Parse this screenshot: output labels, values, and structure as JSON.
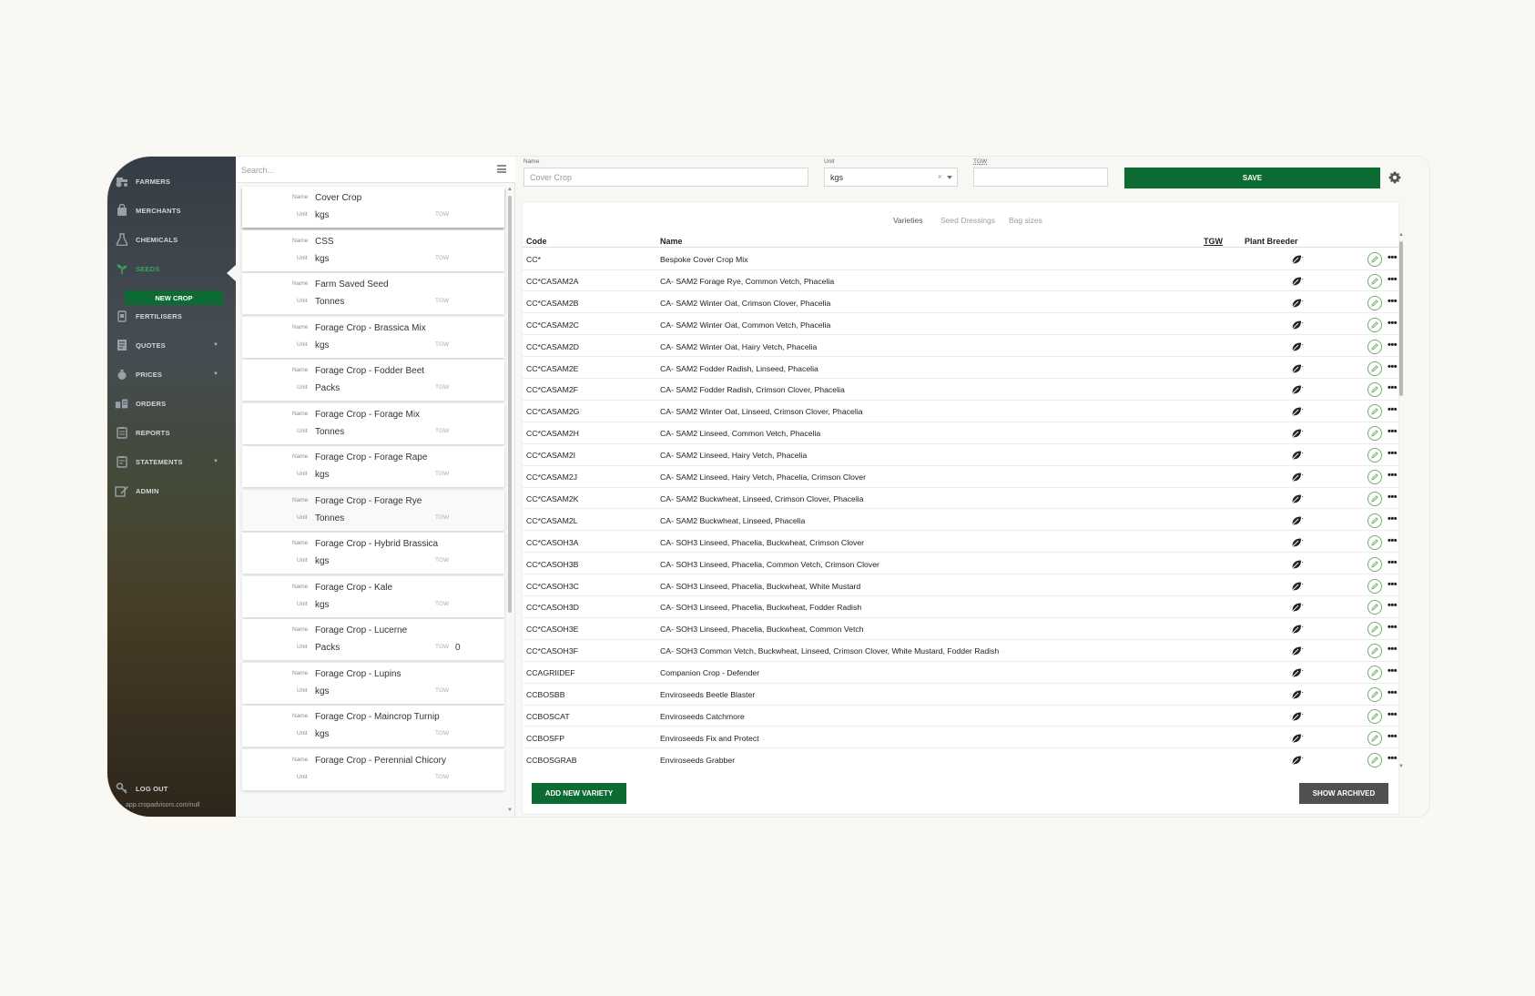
{
  "sidebar": {
    "items": [
      {
        "label": "FARMERS",
        "icon": "tractor-icon"
      },
      {
        "label": "MERCHANTS",
        "icon": "bag-icon"
      },
      {
        "label": "CHEMICALS",
        "icon": "flask-icon"
      },
      {
        "label": "SEEDS",
        "icon": "seedling-icon"
      },
      {
        "label": "FERTILISERS",
        "icon": "fertiliser-icon"
      },
      {
        "label": "QUOTES",
        "icon": "document-icon"
      },
      {
        "label": "PRICES",
        "icon": "money-bag-icon"
      },
      {
        "label": "ORDERS",
        "icon": "orders-icon"
      },
      {
        "label": "REPORTS",
        "icon": "clipboard-icon"
      },
      {
        "label": "STATEMENTS",
        "icon": "statement-icon"
      },
      {
        "label": "ADMIN",
        "icon": "edit-icon"
      }
    ],
    "active": "SEEDS",
    "new_crop_label": "NEW CROP",
    "logout_label": "LOG OUT",
    "footer_url": "app.cropadvisors.com/null"
  },
  "list": {
    "search_placeholder": "Search...",
    "field_labels": {
      "name": "Name",
      "unit": "Unit",
      "tgw": "TGW"
    },
    "crops": [
      {
        "name": "Cover Crop",
        "unit": "kgs",
        "tgw": ""
      },
      {
        "name": "CSS",
        "unit": "kgs",
        "tgw": ""
      },
      {
        "name": "Farm Saved Seed",
        "unit": "Tonnes",
        "tgw": ""
      },
      {
        "name": "Forage Crop - Brassica Mix",
        "unit": "kgs",
        "tgw": ""
      },
      {
        "name": "Forage Crop - Fodder Beet",
        "unit": "Packs",
        "tgw": ""
      },
      {
        "name": "Forage Crop - Forage Mix",
        "unit": "Tonnes",
        "tgw": ""
      },
      {
        "name": "Forage Crop - Forage Rape",
        "unit": "kgs",
        "tgw": ""
      },
      {
        "name": "Forage Crop - Forage Rye",
        "unit": "Tonnes",
        "tgw": ""
      },
      {
        "name": "Forage Crop - Hybrid Brassica",
        "unit": "kgs",
        "tgw": ""
      },
      {
        "name": "Forage Crop - Kale",
        "unit": "kgs",
        "tgw": ""
      },
      {
        "name": "Forage Crop - Lucerne",
        "unit": "Packs",
        "tgw": "0"
      },
      {
        "name": "Forage Crop - Lupins",
        "unit": "kgs",
        "tgw": ""
      },
      {
        "name": "Forage Crop - Maincrop Turnip",
        "unit": "kgs",
        "tgw": ""
      },
      {
        "name": "Forage Crop - Perennial Chicory",
        "unit": "",
        "tgw": ""
      }
    ]
  },
  "form": {
    "name_label": "Name",
    "name_value": "Cover Crop",
    "unit_label": "Unit",
    "unit_value": "kgs",
    "unit_clear": "×",
    "tgw_label": "TGW",
    "tgw_value": "",
    "save_label": "SAVE"
  },
  "tabs": [
    "Varieties",
    "Seed Dressings",
    "Bag sizes"
  ],
  "active_tab": "Varieties",
  "table": {
    "headers": {
      "code": "Code",
      "name": "Name",
      "tgw": "TGW",
      "breeder": "Plant Breeder"
    },
    "rows": [
      {
        "code": "CC*",
        "name": "Bespoke Cover Crop Mix"
      },
      {
        "code": "CC*CASAM2A",
        "name": "CA- SAM2 Forage Rye, Common Vetch, Phacelia"
      },
      {
        "code": "CC*CASAM2B",
        "name": "CA- SAM2 Winter Oat, Crimson Clover, Phacelia"
      },
      {
        "code": "CC*CASAM2C",
        "name": "CA- SAM2 Winter Oat, Common Vetch, Phacelia"
      },
      {
        "code": "CC*CASAM2D",
        "name": "CA- SAM2 Winter Oat, Hairy Vetch, Phacelia"
      },
      {
        "code": "CC*CASAM2E",
        "name": "CA- SAM2 Fodder Radish, Linseed, Phacelia"
      },
      {
        "code": "CC*CASAM2F",
        "name": "CA- SAM2 Fodder Radish, Crimson Clover, Phacelia"
      },
      {
        "code": "CC*CASAM2G",
        "name": "CA- SAM2 Winter Oat, Linseed, Crimson Clover, Phacelia"
      },
      {
        "code": "CC*CASAM2H",
        "name": "CA- SAM2 Linseed, Common Vetch, Phacelia"
      },
      {
        "code": "CC*CASAM2I",
        "name": "CA- SAM2 Linseed, Hairy Vetch, Phacelia"
      },
      {
        "code": "CC*CASAM2J",
        "name": "CA- SAM2 Linseed, Hairy Vetch, Phacelia, Crimson Clover"
      },
      {
        "code": "CC*CASAM2K",
        "name": "CA- SAM2 Buckwheat, Linseed, Crimson Clover, Phacelia"
      },
      {
        "code": "CC*CASAM2L",
        "name": "CA- SAM2 Buckwheat, Linseed, Phacelia"
      },
      {
        "code": "CC*CASOH3A",
        "name": "CA- SOH3 Linseed, Phacelia, Buckwheat, Crimson Clover"
      },
      {
        "code": "CC*CASOH3B",
        "name": "CA- SOH3 Linseed, Phacelia, Common Vetch, Crimson Clover"
      },
      {
        "code": "CC*CASOH3C",
        "name": "CA- SOH3 Linseed, Phacelia, Buckwheat, White Mustard"
      },
      {
        "code": "CC*CASOH3D",
        "name": "CA- SOH3 Linseed, Phacelia, Buckwheat, Fodder Radish"
      },
      {
        "code": "CC*CASOH3E",
        "name": "CA- SOH3 Linseed, Phacelia, Buckwheat, Common Vetch"
      },
      {
        "code": "CC*CASOH3F",
        "name": "CA- SOH3 Common Vetch, Buckwheat, Linseed, Crimson Clover, White Mustard, Fodder Radish"
      },
      {
        "code": "CCAGRIIDEF",
        "name": "Companion Crop - Defender"
      },
      {
        "code": "CCBOSBB",
        "name": "Enviroseeds Beetle Blaster"
      },
      {
        "code": "CCBOSCAT",
        "name": "Enviroseeds Catchmore"
      },
      {
        "code": "CCBOSFP",
        "name": "Enviroseeds Fix and Protect"
      },
      {
        "code": "CCBOSGRAB",
        "name": "Enviroseeds Grabber"
      }
    ]
  },
  "buttons": {
    "add_variety": "ADD NEW VARIETY",
    "show_archived": "SHOW ARCHIVED"
  },
  "colors": {
    "primary_green": "#0b6b33",
    "active_nav_green": "#3ca05a",
    "archive_grey": "#505050"
  }
}
